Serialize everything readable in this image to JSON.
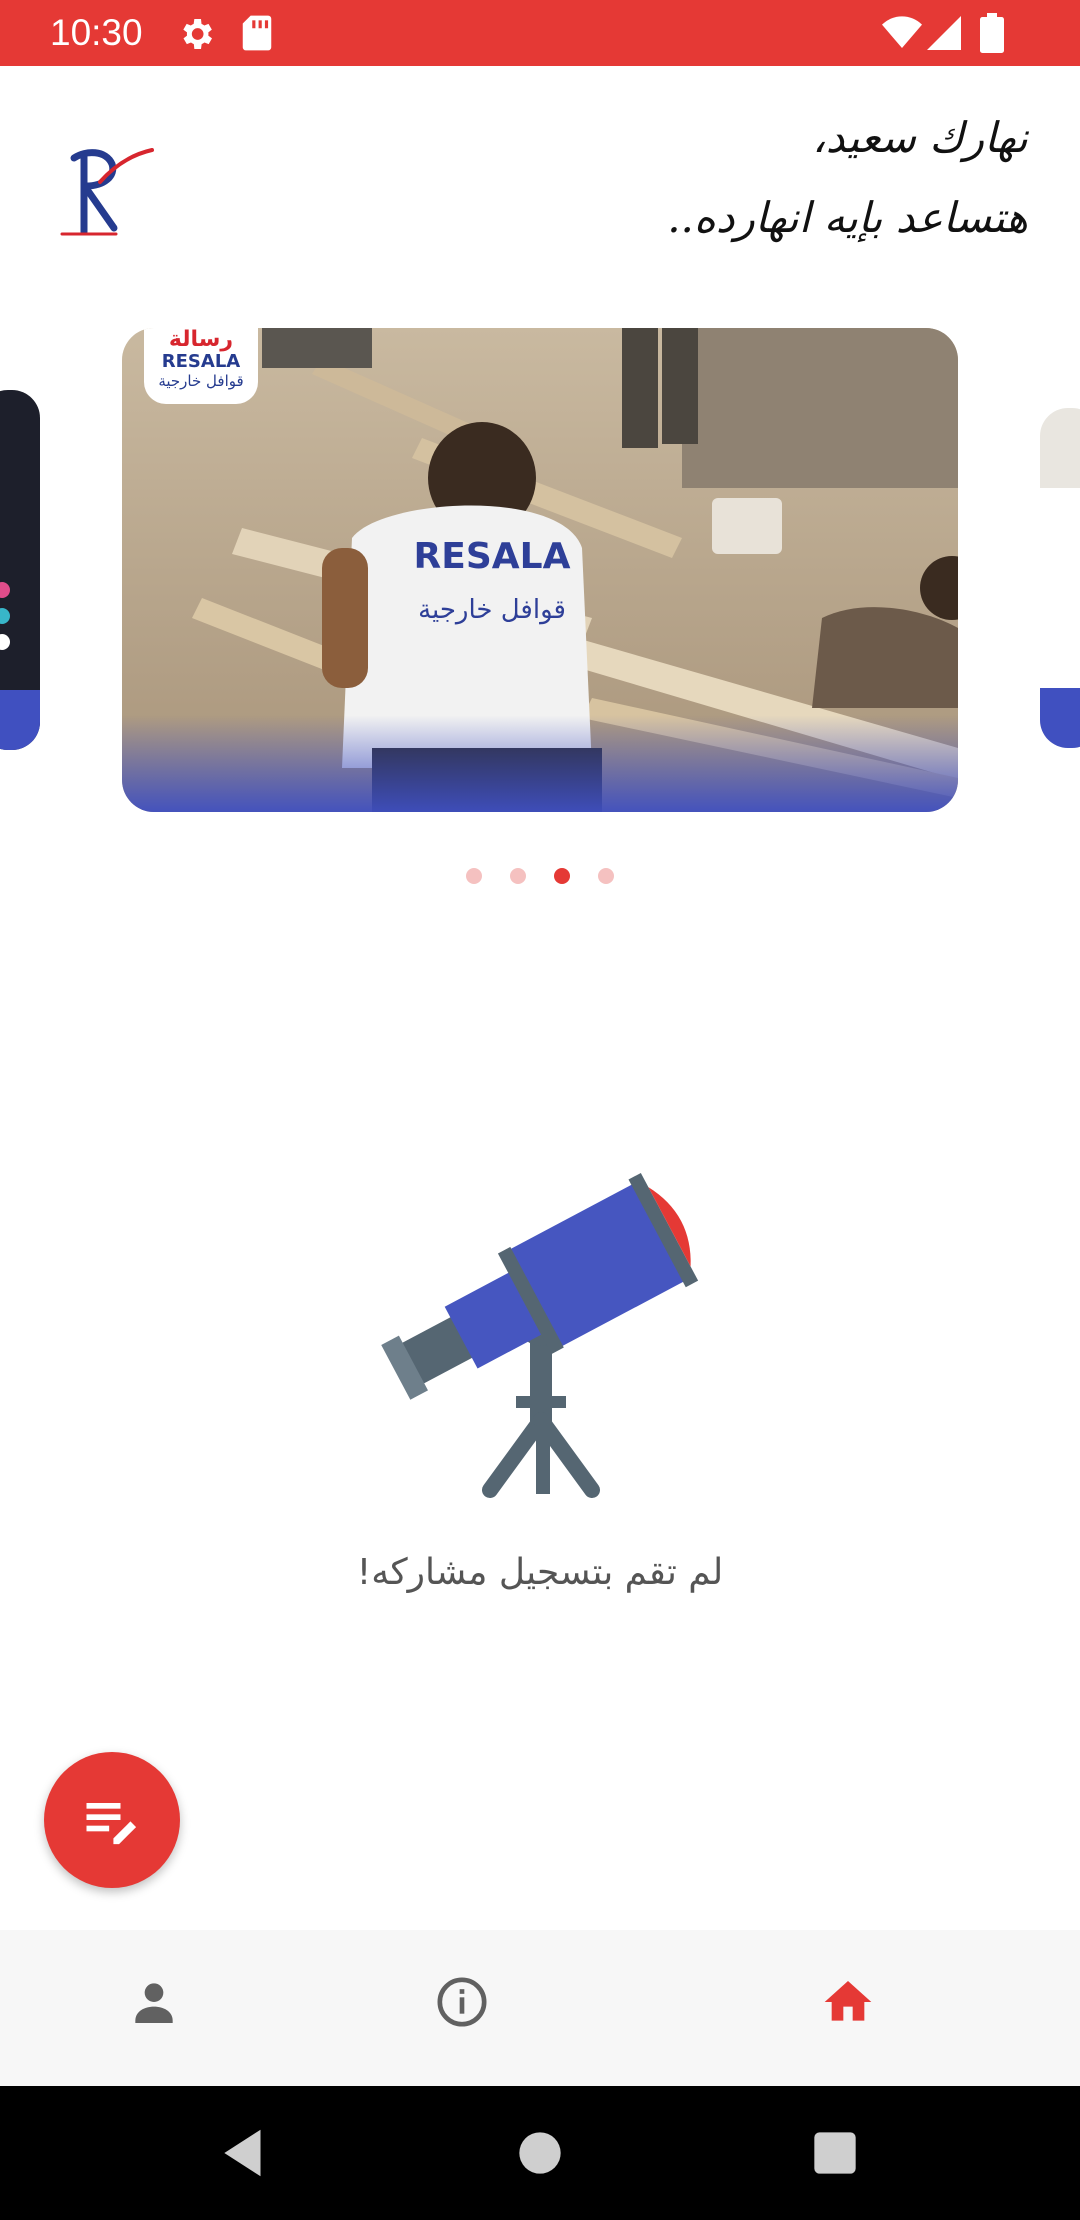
{
  "status_bar": {
    "time": "10:30",
    "icons": [
      "gear-icon",
      "sd-card-icon",
      "wifi-icon",
      "signal-icon",
      "battery-icon"
    ]
  },
  "header": {
    "logo": "resala-logo",
    "greeting_line1": "نهارك سعيد،",
    "greeting_line2": "هتساعد بإيه انهارده.."
  },
  "carousel": {
    "slide_count": 4,
    "active_index": 2,
    "main_slide_badge_text": "RESALA",
    "main_slide_badge_ar1": "رسالة",
    "main_slide_badge_ar2": "قوافل خارجية"
  },
  "empty_state": {
    "icon": "telescope-icon",
    "message": "لم تقم بتسجيل مشاركه!"
  },
  "fab": {
    "icon": "edit-note-icon"
  },
  "bottom_nav": {
    "items": [
      {
        "icon": "person-icon",
        "active": false
      },
      {
        "icon": "info-icon",
        "active": false
      },
      {
        "icon": "home-icon",
        "active": true
      }
    ]
  },
  "colors": {
    "accent": "#e53935",
    "nav_active": "#e53935",
    "nav_inactive": "#616161",
    "telescope_body": "#4656c0"
  }
}
